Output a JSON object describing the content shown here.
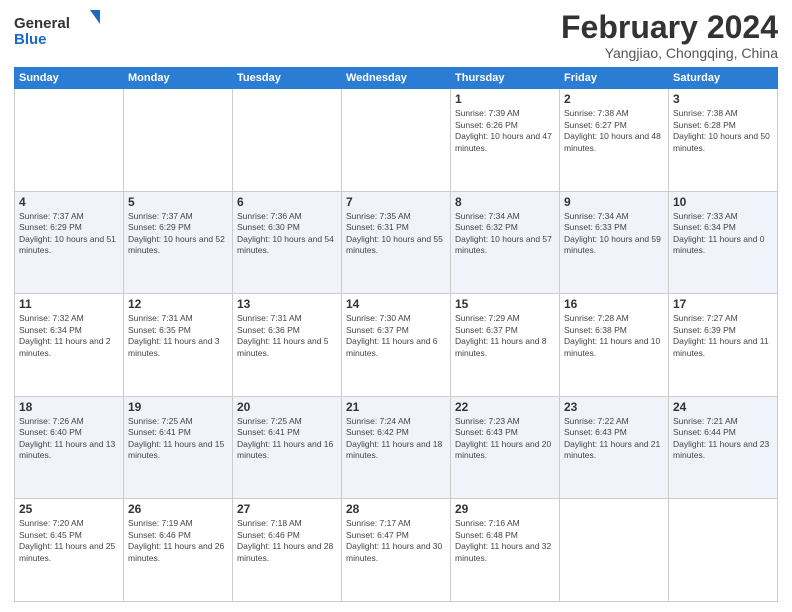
{
  "header": {
    "logo_general": "General",
    "logo_blue": "Blue",
    "title": "February 2024",
    "location": "Yangjiao, Chongqing, China"
  },
  "weekdays": [
    "Sunday",
    "Monday",
    "Tuesday",
    "Wednesday",
    "Thursday",
    "Friday",
    "Saturday"
  ],
  "weeks": [
    [
      {
        "day": "",
        "info": ""
      },
      {
        "day": "",
        "info": ""
      },
      {
        "day": "",
        "info": ""
      },
      {
        "day": "",
        "info": ""
      },
      {
        "day": "1",
        "info": "Sunrise: 7:39 AM\nSunset: 6:26 PM\nDaylight: 10 hours and 47 minutes."
      },
      {
        "day": "2",
        "info": "Sunrise: 7:38 AM\nSunset: 6:27 PM\nDaylight: 10 hours and 48 minutes."
      },
      {
        "day": "3",
        "info": "Sunrise: 7:38 AM\nSunset: 6:28 PM\nDaylight: 10 hours and 50 minutes."
      }
    ],
    [
      {
        "day": "4",
        "info": "Sunrise: 7:37 AM\nSunset: 6:29 PM\nDaylight: 10 hours and 51 minutes."
      },
      {
        "day": "5",
        "info": "Sunrise: 7:37 AM\nSunset: 6:29 PM\nDaylight: 10 hours and 52 minutes."
      },
      {
        "day": "6",
        "info": "Sunrise: 7:36 AM\nSunset: 6:30 PM\nDaylight: 10 hours and 54 minutes."
      },
      {
        "day": "7",
        "info": "Sunrise: 7:35 AM\nSunset: 6:31 PM\nDaylight: 10 hours and 55 minutes."
      },
      {
        "day": "8",
        "info": "Sunrise: 7:34 AM\nSunset: 6:32 PM\nDaylight: 10 hours and 57 minutes."
      },
      {
        "day": "9",
        "info": "Sunrise: 7:34 AM\nSunset: 6:33 PM\nDaylight: 10 hours and 59 minutes."
      },
      {
        "day": "10",
        "info": "Sunrise: 7:33 AM\nSunset: 6:34 PM\nDaylight: 11 hours and 0 minutes."
      }
    ],
    [
      {
        "day": "11",
        "info": "Sunrise: 7:32 AM\nSunset: 6:34 PM\nDaylight: 11 hours and 2 minutes."
      },
      {
        "day": "12",
        "info": "Sunrise: 7:31 AM\nSunset: 6:35 PM\nDaylight: 11 hours and 3 minutes."
      },
      {
        "day": "13",
        "info": "Sunrise: 7:31 AM\nSunset: 6:36 PM\nDaylight: 11 hours and 5 minutes."
      },
      {
        "day": "14",
        "info": "Sunrise: 7:30 AM\nSunset: 6:37 PM\nDaylight: 11 hours and 6 minutes."
      },
      {
        "day": "15",
        "info": "Sunrise: 7:29 AM\nSunset: 6:37 PM\nDaylight: 11 hours and 8 minutes."
      },
      {
        "day": "16",
        "info": "Sunrise: 7:28 AM\nSunset: 6:38 PM\nDaylight: 11 hours and 10 minutes."
      },
      {
        "day": "17",
        "info": "Sunrise: 7:27 AM\nSunset: 6:39 PM\nDaylight: 11 hours and 11 minutes."
      }
    ],
    [
      {
        "day": "18",
        "info": "Sunrise: 7:26 AM\nSunset: 6:40 PM\nDaylight: 11 hours and 13 minutes."
      },
      {
        "day": "19",
        "info": "Sunrise: 7:25 AM\nSunset: 6:41 PM\nDaylight: 11 hours and 15 minutes."
      },
      {
        "day": "20",
        "info": "Sunrise: 7:25 AM\nSunset: 6:41 PM\nDaylight: 11 hours and 16 minutes."
      },
      {
        "day": "21",
        "info": "Sunrise: 7:24 AM\nSunset: 6:42 PM\nDaylight: 11 hours and 18 minutes."
      },
      {
        "day": "22",
        "info": "Sunrise: 7:23 AM\nSunset: 6:43 PM\nDaylight: 11 hours and 20 minutes."
      },
      {
        "day": "23",
        "info": "Sunrise: 7:22 AM\nSunset: 6:43 PM\nDaylight: 11 hours and 21 minutes."
      },
      {
        "day": "24",
        "info": "Sunrise: 7:21 AM\nSunset: 6:44 PM\nDaylight: 11 hours and 23 minutes."
      }
    ],
    [
      {
        "day": "25",
        "info": "Sunrise: 7:20 AM\nSunset: 6:45 PM\nDaylight: 11 hours and 25 minutes."
      },
      {
        "day": "26",
        "info": "Sunrise: 7:19 AM\nSunset: 6:46 PM\nDaylight: 11 hours and 26 minutes."
      },
      {
        "day": "27",
        "info": "Sunrise: 7:18 AM\nSunset: 6:46 PM\nDaylight: 11 hours and 28 minutes."
      },
      {
        "day": "28",
        "info": "Sunrise: 7:17 AM\nSunset: 6:47 PM\nDaylight: 11 hours and 30 minutes."
      },
      {
        "day": "29",
        "info": "Sunrise: 7:16 AM\nSunset: 6:48 PM\nDaylight: 11 hours and 32 minutes."
      },
      {
        "day": "",
        "info": ""
      },
      {
        "day": "",
        "info": ""
      }
    ]
  ]
}
